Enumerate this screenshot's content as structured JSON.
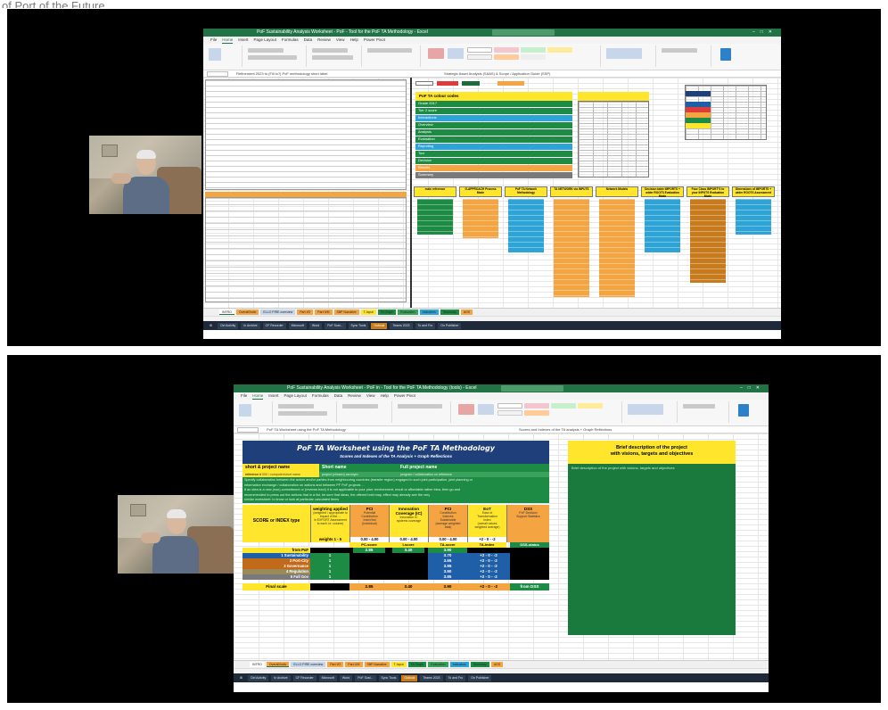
{
  "caption": "of Port of the Future",
  "panel1": {
    "window_title": "PoF Sustainability Analysis Worksheet - PoF - Tool for the PoF TA Methodology - Excel",
    "formula_text": "Refinement 2023 to (Fill in?) PoF methodology short label",
    "formula_right": "Strategic Asset Analysis (SAAS) & Scope / Application Guide (SSP)",
    "menu": [
      "File",
      "Home",
      "Insert",
      "Page Layout",
      "Formulas",
      "Data",
      "Review",
      "View",
      "Help",
      "Power Pivot"
    ],
    "color_table_title": "PoF TA colour codes",
    "color_rows": [
      {
        "label": "Grade 2017",
        "color": "#1d8b44"
      },
      {
        "label": "Tier 2 score",
        "color": "#1d8b44"
      },
      {
        "label": "Interactions",
        "color": "#2ea3d6"
      },
      {
        "label": "Overview",
        "color": "#1d8b44"
      },
      {
        "label": "Analysis",
        "color": "#1d8b44"
      },
      {
        "label": "Evaluation",
        "color": "#1d8b44"
      },
      {
        "label": "Reporting",
        "color": "#2ea3d6"
      },
      {
        "label": "Tool",
        "color": "#1d8b44"
      },
      {
        "label": "Decision",
        "color": "#1d8b44"
      },
      {
        "label": "Results",
        "color": "#f5a442"
      },
      {
        "label": "Summary",
        "color": "#7a7a7a"
      }
    ],
    "flow_headers": [
      "main reference",
      "G-APPROACH Process Mode",
      "PoF TA Network Methodology",
      "TA NETWORK via INPUTS",
      "Network Models",
      "Decision table IMPORTS + wider ROOTS Evaluation Mode",
      "Four Class IMPORT’S to your INPUTS Evaluation Mode",
      "Dimensions of IMPORTS + wider ROOTS Assessment"
    ],
    "tabs": [
      "INTRO",
      "Overall/Indiv",
      "ELLO PIRE overview",
      "Part I/O",
      "Part II/III",
      "SBP Narrative",
      "T-Input",
      "TA Graph",
      "Evaluation",
      "Indicators",
      "Summary",
      "AGS"
    ],
    "taskbar": [
      "Ctrl Activity",
      "In Archive",
      "CF Recorder",
      "Microsoft",
      "Word",
      "PoF Sust...",
      "Sync Tools",
      "Outlook",
      "Teams 2023",
      "To and Fro",
      "On Publisher"
    ]
  },
  "panel2": {
    "window_title": "PoF Sustainability Analysis Worksheet - PoF in - Tool for the PoF TA Methodology (tools) - Excel",
    "formula_text": "PoF TA Worksheet using the PoF TA Methodology",
    "formula_right": "Scores and Indexes of the TA analysis + Graph Reflections",
    "menu": [
      "File",
      "Home",
      "Insert",
      "Page Layout",
      "Formulas",
      "Data",
      "Review",
      "View",
      "Help",
      "Power Pivot"
    ],
    "sheet_title": "PoF TA Worksheet using the PoF TA Methodology",
    "sheet_subtitle": "Scores and Indexes of the TA Analysis + Graph Reflections",
    "short_name_label": "short & project name",
    "short_name_hdr": "Short name",
    "full_name_hdr": "Full project name",
    "reference_label": "reference #",
    "reference_value": "000 / computer/short name",
    "short_name_value": "project (chosen) acronym",
    "full_name_value": "program / collaboration on reference",
    "intro_lines": [
      "Specify collaboration between the actors and/or parties from neighbouring countries (transfer region) engaged in such joint participation, joint planning or",
      "information exchange / collaboration on actions and between PF PoF projects ...",
      "If an idea is a new (non)-commitment or (reverse-fund) it is not applicable to your plan: environment, result or affordable rather idea, then go and",
      "recommended to press out the actions that in a list, be sure that ideas, the offered hold may, effect may already see the very",
      "similar worksheet: to know or look at particular calculated items"
    ],
    "brief_title": "Brief description of the project",
    "brief_sub": "with visions, targets and objectives",
    "brief_text": "Brief description of the project with visions, targets and objectives",
    "score_label": "SCORE or INDEX type",
    "columns": [
      {
        "title": "weighting applied",
        "sub": "(weighted / appropriate to\nimpact of the ...\nin EXPORT Assessment\nto each i.e. column)",
        "range": "weights 1 - 5"
      },
      {
        "title": "PCI",
        "sub": "Potential\nContribution\nIndex/Ind\n(Individual)",
        "range": "0.00 - 4.00"
      },
      {
        "title": "Innovation\nCoverage (IC)",
        "sub": "Innovation IC\nsystems coverage",
        "range": "0.00 - 4.00"
      },
      {
        "title": "PCI",
        "sub": "Contribution\nIndexes\nSustainable\n(average weighted\ntotal)",
        "range": "0.00 - 4.00"
      },
      {
        "title": "EoT",
        "sub": "Ease of\nTransformation\nIndex\n(overall values\nweighted average)",
        "range": "+2 - 0 - -2"
      },
      {
        "title": "DSS",
        "sub": "PoF Decision\nSupport Statistics",
        "range": ""
      }
    ],
    "subheads": [
      "PC-score",
      "I-score",
      "TA-score",
      "TA-index",
      "DSS-status"
    ],
    "rows": [
      {
        "label": "from PoF",
        "weight": "",
        "pci": "2.85",
        "ic": "3.40",
        "ta": "3.90",
        "eot": "",
        "color": "#ffe52b"
      },
      {
        "label": "1 Sustainability",
        "weight": "1",
        "pci": "",
        "ic": "",
        "ta": "3.70",
        "eot": "+2 - 0 - -2",
        "color": "#1f5fa8"
      },
      {
        "label": "2 Port-City",
        "weight": "1",
        "pci": "",
        "ic": "",
        "ta": "3.65",
        "eot": "+2 - 0 - -2",
        "color": "#c06a1a"
      },
      {
        "label": "3 Governance",
        "weight": "1",
        "pci": "",
        "ic": "",
        "ta": "3.95",
        "eot": "+2 - 0 - -2",
        "color": "#c06a1a"
      },
      {
        "label": "4 Regulation",
        "weight": "1",
        "pci": "",
        "ic": "",
        "ta": "3.90",
        "eot": "+2 - 0 - -2",
        "color": "#9a8a5a"
      },
      {
        "label": "5 Full Gov",
        "weight": "1",
        "pci": "",
        "ic": "",
        "ta": "3.85",
        "eot": "+2 - 0 - -2",
        "color": "#7a7a7a"
      }
    ],
    "final_row": {
      "label": "Final scale",
      "pci": "2.85",
      "ic": "3.40",
      "ta": "3.90",
      "eot": "+2 - 0 - -2",
      "dss": "from DSS"
    },
    "tabs": [
      "INTRO",
      "Overall/Indiv",
      "ELLO PIRE overview",
      "Part I/O",
      "Part II/III",
      "SBP Narrative",
      "T-Input",
      "TA Graph",
      "Evaluation",
      "Indicators",
      "Summary",
      "AGS"
    ],
    "taskbar": [
      "Ctrl Activity",
      "In Archive",
      "CF Recorder",
      "Microsoft",
      "Word",
      "PoF Sust...",
      "Sync Tools",
      "Outlook",
      "Teams 2023",
      "To and Fro",
      "On Publisher"
    ]
  }
}
